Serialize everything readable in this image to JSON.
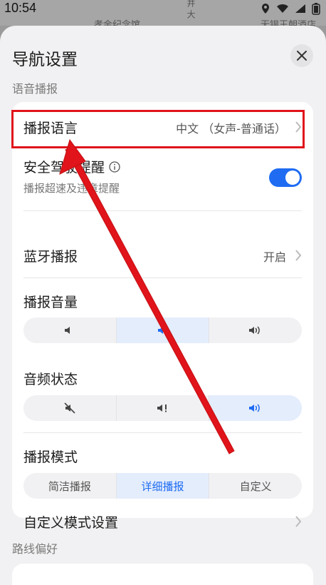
{
  "status_bar": {
    "time": "10:54",
    "map_left": "孝金纪念馆",
    "map_right": "无锡王朝酒店",
    "map_vertical": "井 大"
  },
  "header": {
    "title": "导航设置"
  },
  "sections": {
    "voice": "语音播报",
    "route": "路线偏好"
  },
  "rows": {
    "language": {
      "label": "播报语言",
      "value": "中文 （女声-普通话）"
    },
    "safe_driving": {
      "label": "安全驾驶提醒",
      "sub": "播报超速及违章提醒",
      "enabled": true
    },
    "bluetooth": {
      "label": "蓝牙播报",
      "value": "开启"
    },
    "volume": {
      "label": "播报音量",
      "selected_index": 1
    },
    "audio_state": {
      "label": "音频状态",
      "selected_index": 2
    },
    "mode": {
      "label": "播报模式",
      "options": [
        "简洁播报",
        "详细播报",
        "自定义"
      ],
      "selected_index": 1
    },
    "custom_mode": {
      "label": "自定义模式设置"
    }
  },
  "colors": {
    "accent": "#1f6cf2",
    "annotation": "#e0141a"
  }
}
